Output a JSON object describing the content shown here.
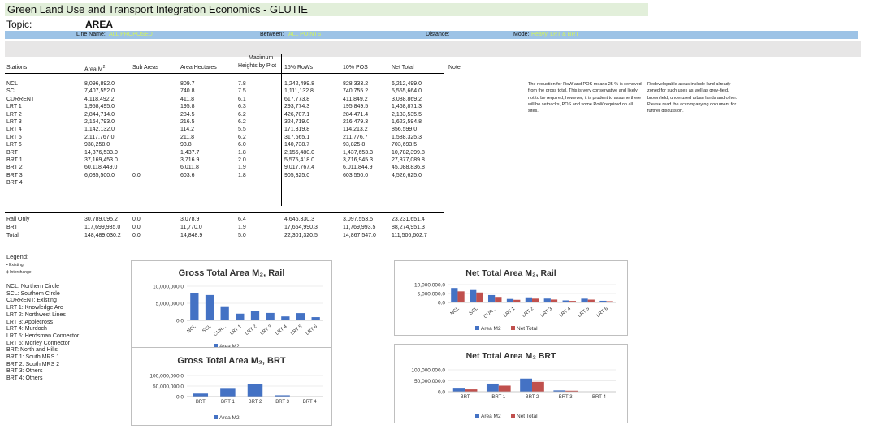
{
  "title": "Green Land Use and Transport Integration Economics - GLUTIE",
  "topic": {
    "label": "Topic:",
    "value": "AREA"
  },
  "filters": {
    "line_label": "Line Name:",
    "line_value": "ALL PROPOSED",
    "between_label": "Between:",
    "between_value": "ALL POINTS",
    "distance_label": "Distance:",
    "mode_label": "Mode:",
    "mode_value": "Heavy, LRT & BRT"
  },
  "table": {
    "headers": {
      "stations": "Stations",
      "area": "Area  M",
      "area_sup": "2",
      "sub_areas": "Sub Areas",
      "hectares": "Area Hectares",
      "heights_1": "Maximum",
      "heights_2": "Heights by Plot",
      "rows": "15% RoWs",
      "pos": "10% POS",
      "net": "Net Total",
      "note": "Note"
    },
    "rows": [
      [
        "NCL",
        "8,096,892.0",
        "",
        "809.7",
        "7.8",
        "1,242,499.8",
        "828,333.2",
        "6,212,499.0"
      ],
      [
        "SCL",
        "7,407,552.0",
        "",
        "740.8",
        "7.5",
        "1,111,132.8",
        "740,755.2",
        "5,555,664.0"
      ],
      [
        "CURRENT",
        "4,118,492.2",
        "",
        "411.8",
        "6.1",
        "617,773.8",
        "411,849.2",
        "3,088,869.2"
      ],
      [
        "LRT 1",
        "1,958,495.0",
        "",
        "195.8",
        "6.3",
        "293,774.3",
        "195,849.5",
        "1,468,871.3"
      ],
      [
        "LRT 2",
        "2,844,714.0",
        "",
        "284.5",
        "6.2",
        "426,707.1",
        "284,471.4",
        "2,133,535.5"
      ],
      [
        "LRT 3",
        "2,164,793.0",
        "",
        "216.5",
        "6.2",
        "324,719.0",
        "216,479.3",
        "1,623,594.8"
      ],
      [
        "LRT 4",
        "1,142,132.0",
        "",
        "114.2",
        "5.5",
        "171,319.8",
        "114,213.2",
        "856,599.0"
      ],
      [
        "LRT 5",
        "2,117,767.0",
        "",
        "211.8",
        "6.2",
        "317,665.1",
        "211,776.7",
        "1,588,325.3"
      ],
      [
        "LRT 6",
        "938,258.0",
        "",
        "93.8",
        "6.0",
        "140,738.7",
        "93,825.8",
        "703,693.5"
      ],
      [
        "BRT",
        "14,376,533.0",
        "",
        "1,437.7",
        "1.8",
        "2,156,480.0",
        "1,437,653.3",
        "10,782,399.8"
      ],
      [
        "BRT 1",
        "37,169,453.0",
        "",
        "3,716.9",
        "2.0",
        "5,575,418.0",
        "3,716,945.3",
        "27,877,089.8"
      ],
      [
        "BRT 2",
        "60,118,449.0",
        "",
        "6,011.8",
        "1.9",
        "9,017,767.4",
        "6,011,844.9",
        "45,088,836.8"
      ],
      [
        "BRT 3",
        "6,035,500.0",
        "0.0",
        "603.6",
        "1.8",
        "905,325.0",
        "603,550.0",
        "4,526,625.0"
      ],
      [
        "BRT 4",
        "",
        "",
        "",
        "",
        "",
        "",
        ""
      ]
    ],
    "totals": [
      [
        "Rail Only",
        "30,789,095.2",
        "0.0",
        "3,078.9",
        "6.4",
        "4,646,330.3",
        "3,097,553.5",
        "23,231,651.4"
      ],
      [
        "BRT",
        "117,699,935.0",
        "0.0",
        "11,770.0",
        "1.9",
        "17,654,990.3",
        "11,769,993.5",
        "88,274,951.3"
      ],
      [
        "Total",
        "148,489,030.2",
        "0.0",
        "14,848.9",
        "5.0",
        "22,301,320.5",
        "14,867,547.0",
        "111,506,602.7"
      ]
    ]
  },
  "notes": {
    "rows_pos": "The reduction for RoW and POS means 25 % is removed from the gross total. This is very conservative and likely not to be required, however, it is prudent to assume there will be setbacks, POS and some RoW required on all sites.",
    "redevelopable": "Redevelopable areas include land already zoned for such uses as well as grey-field, brownfield, underused urban lands and other. Please read the accompanying document for further discussion."
  },
  "legend": {
    "title": "Legend:",
    "markers": [
      "Existing",
      "Interchange"
    ],
    "items": [
      "NCL: Northern Circle",
      "SCL: Southern Circle",
      "CURRENT: Existing",
      "LRT 1: Knowledge Arc",
      "LRT 2: Northwest Lines",
      "LRT 3: Applecross",
      "LRT 4: Murdoch",
      "LRT 5: Herdsman Connector",
      "LRT 6: Morley Connector",
      "BRT: North and Hills",
      "BRT 1: South MRS 1",
      "BRT 2: South MRS 2",
      "BRT 3: Others",
      "BRT 4: Others"
    ]
  },
  "colors": {
    "area": "#4472c4",
    "net": "#c0504d",
    "title_bar": "#e2efda",
    "filter_bar": "#9dc3e6"
  },
  "chart_data": [
    {
      "type": "bar",
      "title": "Gross Total Area  M₂, Rail",
      "categories": [
        "NCL",
        "SCL",
        "CUR...",
        "LRT 1",
        "LRT 2",
        "LRT 3",
        "LRT 4",
        "LRT 5",
        "LRT 6"
      ],
      "series": [
        {
          "name": "Area  M2",
          "values": [
            8096892.0,
            7407552.0,
            4118492.2,
            1958495.0,
            2844714.0,
            2164793.0,
            1142132.0,
            2117767.0,
            938258.0
          ]
        }
      ],
      "yticks": [
        "10,000,000.0",
        "5,000,000.0",
        "0.0"
      ],
      "ylim": [
        0,
        10000000
      ]
    },
    {
      "type": "bar",
      "title": "Net Total Area M₂, Rail",
      "categories": [
        "NCL",
        "SCL",
        "CUR...",
        "LRT 1",
        "LRT 2",
        "LRT 3",
        "LRT 4",
        "LRT 5",
        "LRT 6"
      ],
      "series": [
        {
          "name": "Area  M2",
          "values": [
            8096892.0,
            7407552.0,
            4118492.2,
            1958495.0,
            2844714.0,
            2164793.0,
            1142132.0,
            2117767.0,
            938258.0
          ]
        },
        {
          "name": "Net Total",
          "values": [
            6212499.0,
            5555664.0,
            3088869.2,
            1468871.3,
            2133535.5,
            1623594.8,
            856599.0,
            1588325.3,
            703693.5
          ]
        }
      ],
      "yticks": [
        "10,000,000.0",
        "5,000,000.0",
        "0.0"
      ],
      "ylim": [
        0,
        10000000
      ]
    },
    {
      "type": "bar",
      "title": "Gross Total Area  M₂, BRT",
      "categories": [
        "BRT",
        "BRT 1",
        "BRT 2",
        "BRT 3",
        "BRT 4"
      ],
      "series": [
        {
          "name": "Area  M2",
          "values": [
            14376533.0,
            37169453.0,
            60118449.0,
            6035500.0,
            0
          ]
        }
      ],
      "yticks": [
        "100,000,000.0",
        "50,000,000.0",
        "0.0"
      ],
      "ylim": [
        0,
        100000000
      ]
    },
    {
      "type": "bar",
      "title": "Net Total Area M₂ BRT",
      "categories": [
        "BRT",
        "BRT 1",
        "BRT 2",
        "BRT 3",
        "BRT 4"
      ],
      "series": [
        {
          "name": "Area  M2",
          "values": [
            14376533.0,
            37169453.0,
            60118449.0,
            6035500.0,
            0
          ]
        },
        {
          "name": "Net Total",
          "values": [
            10782399.8,
            27877089.8,
            45088836.8,
            4526625.0,
            0
          ]
        }
      ],
      "yticks": [
        "100,000,000.0",
        "50,000,000.0",
        "0.0"
      ],
      "ylim": [
        0,
        100000000
      ]
    }
  ]
}
